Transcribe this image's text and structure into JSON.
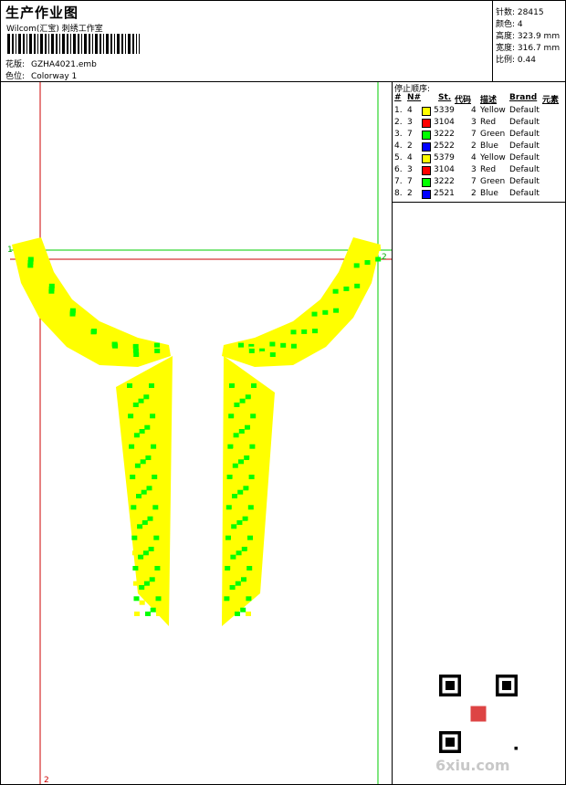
{
  "header": {
    "title": "生产作业图",
    "company": "Wilcom(汇宝) 刺绣工作室",
    "design_label": "花版:",
    "design_file": "GZHA4021.emb",
    "colorway_label": "色位:",
    "colorway": "Colorway 1"
  },
  "stats": [
    {
      "label": "针数:",
      "value": "28415"
    },
    {
      "label": "颜色:",
      "value": "4"
    },
    {
      "label": "高度:",
      "value": "323.9 mm"
    },
    {
      "label": "宽度:",
      "value": "316.7 mm"
    },
    {
      "label": "比例:",
      "value": "0.44"
    }
  ],
  "stop_sequence": {
    "title": "停止顺序:",
    "columns": [
      "#",
      "N#",
      "St.",
      "代码",
      "描述",
      "Brand",
      "元素"
    ],
    "rows": [
      {
        "idx": "1.",
        "n": "4",
        "color": "#ffff00",
        "st": "5339",
        "code": "4",
        "desc": "Yellow",
        "brand": "Default"
      },
      {
        "idx": "2.",
        "n": "3",
        "color": "#ff0000",
        "st": "3104",
        "code": "3",
        "desc": "Red",
        "brand": "Default"
      },
      {
        "idx": "3.",
        "n": "7",
        "color": "#00ff00",
        "st": "3222",
        "code": "7",
        "desc": "Green",
        "brand": "Default"
      },
      {
        "idx": "4.",
        "n": "2",
        "color": "#0000ff",
        "st": "2522",
        "code": "2",
        "desc": "Blue",
        "brand": "Default"
      },
      {
        "idx": "5.",
        "n": "4",
        "color": "#ffff00",
        "st": "5379",
        "code": "4",
        "desc": "Yellow",
        "brand": "Default"
      },
      {
        "idx": "6.",
        "n": "3",
        "color": "#ff0000",
        "st": "3104",
        "code": "3",
        "desc": "Red",
        "brand": "Default"
      },
      {
        "idx": "7.",
        "n": "7",
        "color": "#00ff00",
        "st": "3222",
        "code": "7",
        "desc": "Green",
        "brand": "Default"
      },
      {
        "idx": "8.",
        "n": "2",
        "color": "#0000ff",
        "st": "2521",
        "code": "2",
        "desc": "Blue",
        "brand": "Default"
      }
    ]
  },
  "canvas": {
    "guide_labels": [
      "1",
      "2",
      "2"
    ],
    "palette": {
      "yellow": "#ffff00",
      "red": "#ff0000",
      "green": "#00ff00",
      "blue": "#0000ff",
      "guide_green": "#00cc00",
      "guide_red": "#cc0000"
    }
  },
  "watermark": "6xiu.com"
}
